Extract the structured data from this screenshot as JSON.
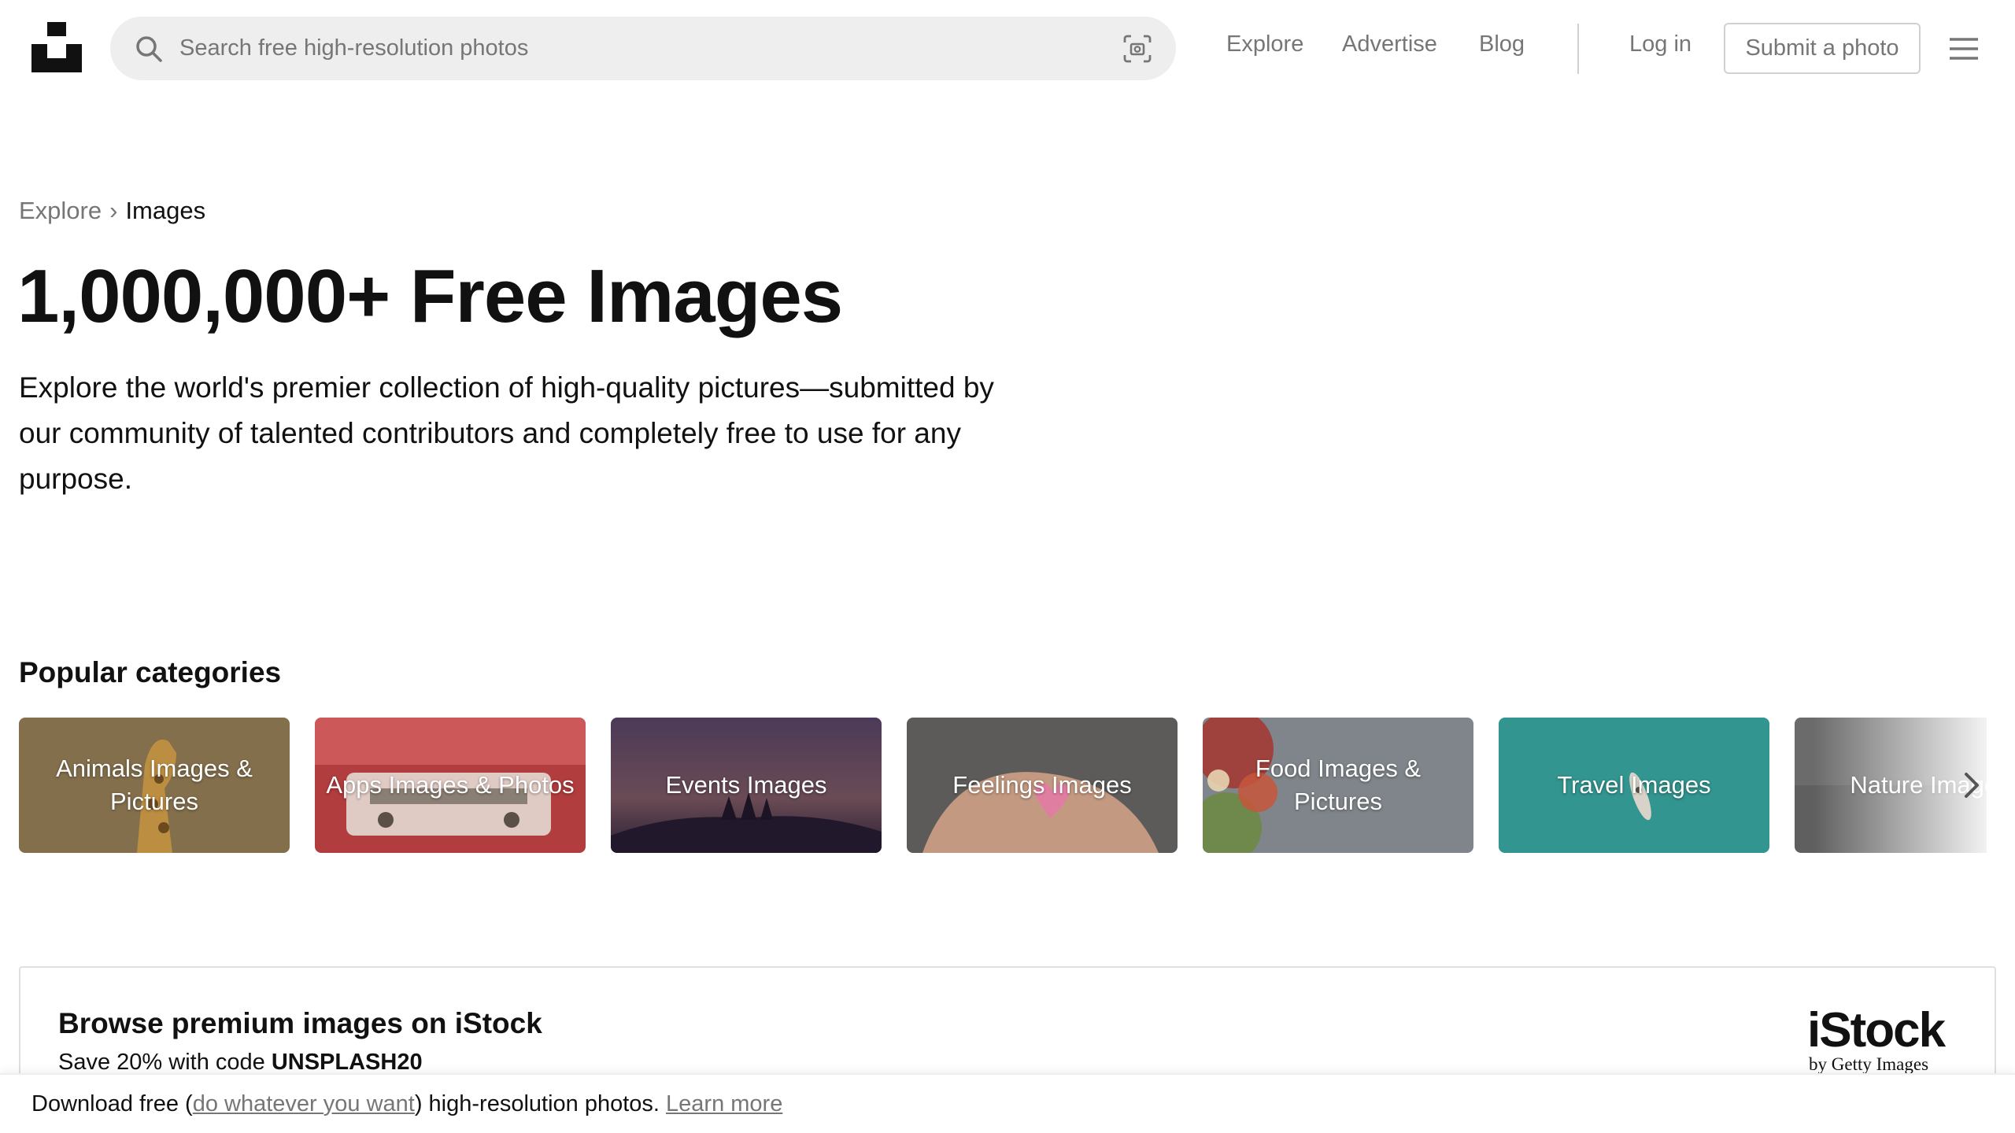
{
  "header": {
    "logo_name": "Unsplash",
    "search": {
      "placeholder": "Search free high-resolution photos",
      "value": ""
    },
    "nav": [
      {
        "label": "Explore"
      },
      {
        "label": "Advertise"
      },
      {
        "label": "Blog"
      }
    ],
    "login_label": "Log in",
    "submit_label": "Submit a photo"
  },
  "breadcrumb": {
    "parent": "Explore",
    "separator": "›",
    "current": "Images"
  },
  "hero": {
    "title": "1,000,000+ Free Images",
    "description": "Explore the world's premier collection of high-quality pictures—submitted by our community of talented contributors and completely free to use for any purpose."
  },
  "categories": {
    "title": "Popular categories",
    "items": [
      {
        "label": "Animals Images & Pictures",
        "color": "#8a7350"
      },
      {
        "label": "Apps Images & Photos",
        "color": "#a83a3c"
      },
      {
        "label": "Events Images",
        "color": "#3b2a45"
      },
      {
        "label": "Feelings Images",
        "color": "#6e6a66"
      },
      {
        "label": "Food Images & Pictures",
        "color": "#7d8287"
      },
      {
        "label": "Travel Images",
        "color": "#2c8a86"
      },
      {
        "label": "Nature Images",
        "color": "#6b6b6b"
      }
    ]
  },
  "promo": {
    "title": "Browse premium images on iStock",
    "subtitle_prefix": "Save 20% with code ",
    "code": "UNSPLASH20",
    "logo_word": "iStock",
    "logo_by": "by Getty Images"
  },
  "notice": {
    "prefix": "Download free (",
    "link": "do whatever you want",
    "middle": ") high-resolution photos. ",
    "learn_more": "Learn more"
  },
  "icons": [
    "unsplash-logo-icon",
    "search-icon",
    "visual-search-icon",
    "menu-icon",
    "chevron-right-icon"
  ]
}
